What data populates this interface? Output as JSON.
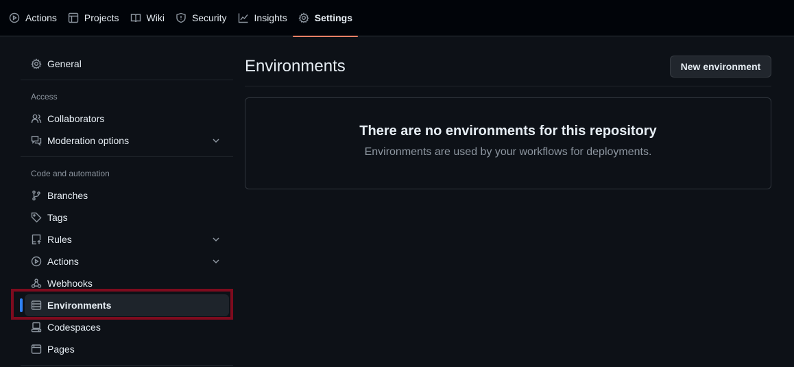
{
  "topnav": {
    "tabs": [
      {
        "label": "Actions",
        "icon": "play-circle-icon"
      },
      {
        "label": "Projects",
        "icon": "table-icon"
      },
      {
        "label": "Wiki",
        "icon": "book-icon"
      },
      {
        "label": "Security",
        "icon": "shield-icon"
      },
      {
        "label": "Insights",
        "icon": "graph-icon"
      },
      {
        "label": "Settings",
        "icon": "gear-icon",
        "active": true
      }
    ]
  },
  "sidebar": {
    "general": "General",
    "access_heading": "Access",
    "collaborators": "Collaborators",
    "moderation": "Moderation options",
    "code_heading": "Code and automation",
    "branches": "Branches",
    "tags": "Tags",
    "rules": "Rules",
    "actions": "Actions",
    "webhooks": "Webhooks",
    "environments": "Environments",
    "codespaces": "Codespaces",
    "pages": "Pages"
  },
  "main": {
    "title": "Environments",
    "new_button": "New environment",
    "blank_title": "There are no environments for this repository",
    "blank_text": "Environments are used by your workflows for deployments."
  },
  "colors": {
    "background": "#0d1117",
    "topnav_bg": "#010409",
    "active_underline": "#f78166",
    "active_indicator": "#2f81f7",
    "highlight_box": "#7e0b1e"
  }
}
